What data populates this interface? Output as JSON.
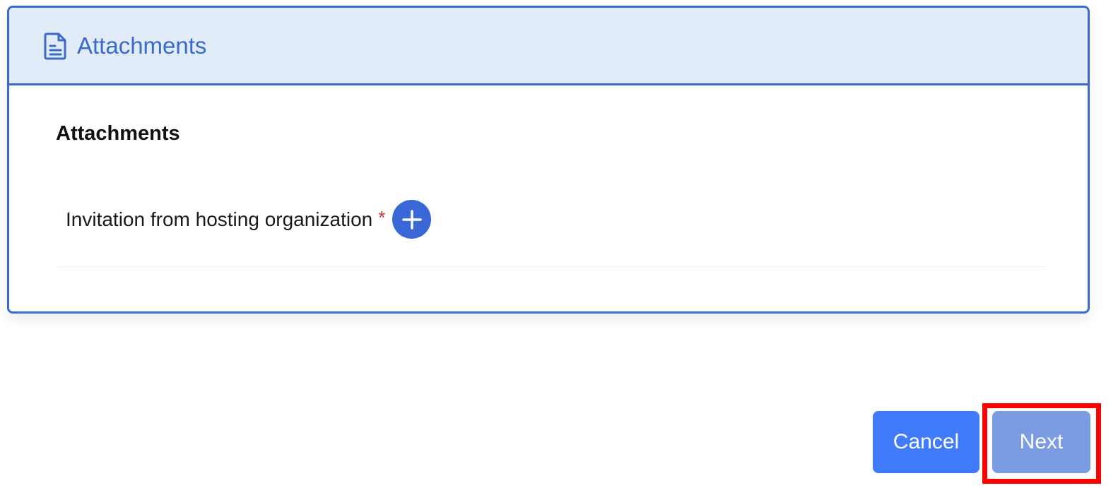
{
  "card": {
    "header_title": "Attachments",
    "header_icon": "document-icon",
    "section_title": "Attachments",
    "field": {
      "label": "Invitation from hosting organization",
      "required_mark": "*",
      "add_icon": "plus-icon"
    }
  },
  "actions": {
    "cancel_label": "Cancel",
    "next_label": "Next"
  },
  "colors": {
    "accent": "#3a6bc9",
    "header_bg": "#e1ecf8",
    "cancel_bg": "#3f7bfa",
    "next_bg": "#7b9be3",
    "required": "#d0343f",
    "highlight": "#ff0000"
  }
}
